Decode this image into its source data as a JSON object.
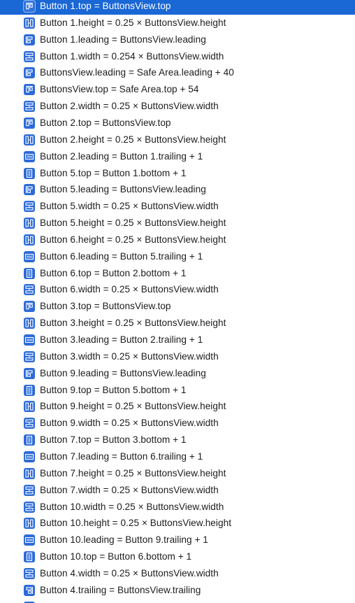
{
  "window": {
    "title": ""
  },
  "constraints": [
    {
      "label": "Button 1.top = ButtonsView.top",
      "icon": "align-top-icon",
      "selected": true
    },
    {
      "label": "Button 1.height = 0.25 × ButtonsView.height",
      "icon": "height-constraint-icon"
    },
    {
      "label": "Button 1.leading = ButtonsView.leading",
      "icon": "align-leading-icon"
    },
    {
      "label": "Button 1.width = 0.254 × ButtonsView.width",
      "icon": "width-constraint-icon"
    },
    {
      "label": "ButtonsView.leading = Safe Area.leading + 40",
      "icon": "align-leading-icon"
    },
    {
      "label": "ButtonsView.top = Safe Area.top + 54",
      "icon": "align-top-icon"
    },
    {
      "label": "Button 2.width = 0.25 × ButtonsView.width",
      "icon": "width-constraint-icon"
    },
    {
      "label": "Button 2.top = ButtonsView.top",
      "icon": "align-top-icon"
    },
    {
      "label": "Button 2.height = 0.25 × ButtonsView.height",
      "icon": "height-constraint-icon"
    },
    {
      "label": "Button 2.leading = Button 1.trailing + 1",
      "icon": "horizontal-spacing-icon"
    },
    {
      "label": "Button 5.top = Button 1.bottom + 1",
      "icon": "vertical-spacing-icon"
    },
    {
      "label": "Button 5.leading = ButtonsView.leading",
      "icon": "align-leading-icon"
    },
    {
      "label": "Button 5.width = 0.25 × ButtonsView.width",
      "icon": "width-constraint-icon"
    },
    {
      "label": "Button 5.height = 0.25 × ButtonsView.height",
      "icon": "height-constraint-icon"
    },
    {
      "label": "Button 6.height = 0.25 × ButtonsView.height",
      "icon": "height-constraint-icon"
    },
    {
      "label": "Button 6.leading = Button 5.trailing + 1",
      "icon": "horizontal-spacing-icon"
    },
    {
      "label": "Button 6.top = Button 2.bottom + 1",
      "icon": "vertical-spacing-icon"
    },
    {
      "label": "Button 6.width = 0.25 × ButtonsView.width",
      "icon": "width-constraint-icon"
    },
    {
      "label": "Button 3.top = ButtonsView.top",
      "icon": "align-top-icon"
    },
    {
      "label": "Button 3.height = 0.25 × ButtonsView.height",
      "icon": "height-constraint-icon"
    },
    {
      "label": "Button 3.leading = Button 2.trailing + 1",
      "icon": "horizontal-spacing-icon"
    },
    {
      "label": "Button 3.width = 0.25 × ButtonsView.width",
      "icon": "width-constraint-icon"
    },
    {
      "label": "Button 9.leading = ButtonsView.leading",
      "icon": "align-leading-icon"
    },
    {
      "label": "Button 9.top = Button 5.bottom + 1",
      "icon": "vertical-spacing-icon"
    },
    {
      "label": "Button 9.height = 0.25 × ButtonsView.height",
      "icon": "height-constraint-icon"
    },
    {
      "label": "Button 9.width = 0.25 × ButtonsView.width",
      "icon": "width-constraint-icon"
    },
    {
      "label": "Button 7.top = Button 3.bottom + 1",
      "icon": "vertical-spacing-icon"
    },
    {
      "label": "Button 7.leading = Button 6.trailing + 1",
      "icon": "horizontal-spacing-icon"
    },
    {
      "label": "Button 7.height = 0.25 × ButtonsView.height",
      "icon": "height-constraint-icon"
    },
    {
      "label": "Button 7.width = 0.25 × ButtonsView.width",
      "icon": "width-constraint-icon"
    },
    {
      "label": "Button 10.width = 0.25 × ButtonsView.width",
      "icon": "width-constraint-icon"
    },
    {
      "label": "Button 10.height = 0.25 × ButtonsView.height",
      "icon": "height-constraint-icon"
    },
    {
      "label": "Button 10.leading = Button 9.trailing + 1",
      "icon": "horizontal-spacing-icon"
    },
    {
      "label": "Button 10.top = Button 6.bottom + 1",
      "icon": "vertical-spacing-icon"
    },
    {
      "label": "Button 4.width = 0.25 × ButtonsView.width",
      "icon": "width-constraint-icon"
    },
    {
      "label": "Button 4.trailing = ButtonsView.trailing",
      "icon": "align-trailing-icon"
    },
    {
      "label": "",
      "icon": "height-constraint-icon"
    }
  ],
  "colors": {
    "selection": "#1a67d6",
    "icon": "#2c6ad9",
    "text": "#1c1c1c"
  }
}
